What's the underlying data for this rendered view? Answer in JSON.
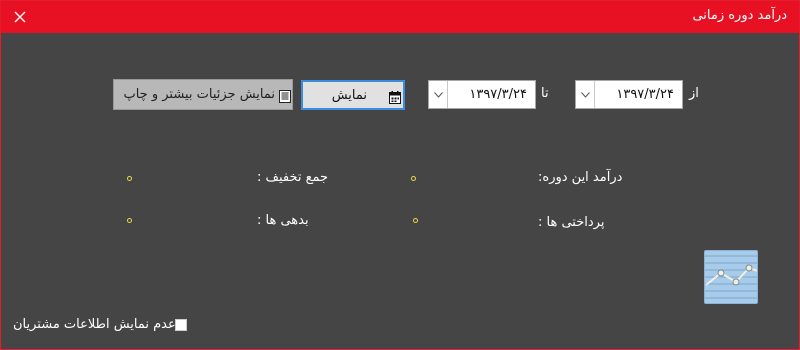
{
  "window": {
    "title": "درآمد دوره زمانی"
  },
  "filter": {
    "from_label": "از",
    "from_date": "۱۳۹۷/۳/۲۴",
    "to_label": "تا",
    "to_date": "۱۳۹۷/۳/۲۴",
    "show_button": "نمایش",
    "print_button": "نمایش جزئیات بیشتر و چاپ"
  },
  "summary": {
    "period_income_label": "درآمد این دوره:",
    "total_discount_label": "جمع تخفیف :",
    "payments_label": "پرداختی ها :",
    "debts_label": "بدهی ها :"
  },
  "options": {
    "hide_customer_info_label": "عدم نمایش اطلاعات مشتریان",
    "hide_customer_info_checked": false
  },
  "icons": {
    "close": "close-icon",
    "calendar": "calendar-icon",
    "list": "list-icon",
    "chart": "line-chart-icon"
  },
  "colors": {
    "titlebar": "#e81123",
    "background": "#454545",
    "accent": "#3c8dde",
    "dot": "#e8d84a"
  }
}
